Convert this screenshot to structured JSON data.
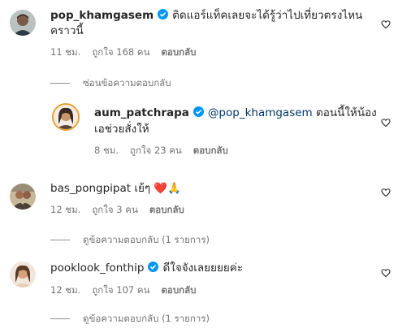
{
  "comments": [
    {
      "username": "pop_khamgasem",
      "verified": true,
      "text_line1": "ติดแอร์แท็คเลยจะได้รู้ว่าไปเที่ยวตรงไหน",
      "text_line2": "คราวนี้",
      "time": "11 ชม.",
      "likes": "ถูกใจ 168 คน",
      "reply_label": "ตอบกลับ",
      "thread_toggle": "ซ่อนข้อความตอบกลับ"
    },
    {
      "username": "aum_patchrapa",
      "verified": true,
      "mention": "@pop_khamgasem",
      "text_line1": "ตอนนี้ให้น้อง",
      "text_line2": "เอช่วยสั่งให้",
      "time": "8 ชม.",
      "likes": "ถูกใจ 23 คน",
      "reply_label": "ตอบกลับ"
    },
    {
      "username": "bas_pongpipat",
      "verified": false,
      "text": "เย้ๆ",
      "emoji": "❤️🙏",
      "time": "12 ชม.",
      "likes": "ถูกใจ 3 คน",
      "reply_label": "ตอบกลับ",
      "thread_toggle": "ดูข้อความตอบกลับ (1 รายการ)"
    },
    {
      "username": "pooklook_fonthip",
      "verified": true,
      "text": "ดีใจจังเลยยยยค่ะ",
      "time": "12 ชม.",
      "likes": "ถูกใจ 107 คน",
      "reply_label": "ตอบกลับ",
      "thread_toggle": "ดูข้อความตอบกลับ (1 รายการ)"
    }
  ],
  "colors": {
    "verified_blue": "#0095f6",
    "mention_blue": "#00376b",
    "meta_gray": "#737373"
  }
}
